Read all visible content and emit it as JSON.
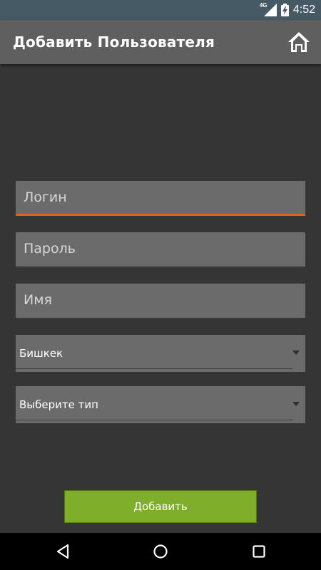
{
  "status_bar": {
    "network": "4G",
    "time": "4:52",
    "icons": [
      "signal-icon",
      "battery-charging-icon"
    ]
  },
  "toolbar": {
    "title": "Добавить Пользователя",
    "home_icon": "home-icon"
  },
  "form": {
    "login_placeholder": "Логин",
    "password_placeholder": "Пароль",
    "name_placeholder": "Имя",
    "city_selected": "Бишкек",
    "type_selected": "Выберите тип",
    "submit_label": "Добавить"
  },
  "nav": {
    "icons": [
      "back-icon",
      "home-circle-icon",
      "recents-icon"
    ]
  },
  "colors": {
    "accent": "#e0601c",
    "button": "#7faf2a",
    "toolbar": "#5f5f5f",
    "status_bar": "#455a64",
    "background": "#353535"
  }
}
